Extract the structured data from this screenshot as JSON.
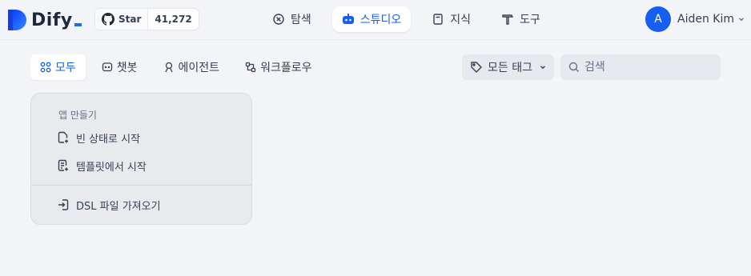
{
  "brand": {
    "name": "Dify",
    "accent": "#155eef"
  },
  "github": {
    "star_label": "Star",
    "star_count": "41,272"
  },
  "nav": [
    {
      "label": "탐색",
      "icon": "explore-icon",
      "active": false
    },
    {
      "label": "스튜디오",
      "icon": "robot-icon",
      "active": true
    },
    {
      "label": "지식",
      "icon": "book-icon",
      "active": false
    },
    {
      "label": "도구",
      "icon": "hammer-icon",
      "active": false
    }
  ],
  "user": {
    "initial": "A",
    "name": "Aiden Kim"
  },
  "filters": [
    {
      "label": "모두",
      "icon": "grid-icon",
      "active": true
    },
    {
      "label": "챗봇",
      "icon": "chat-icon",
      "active": false
    },
    {
      "label": "에이전트",
      "icon": "agent-icon",
      "active": false
    },
    {
      "label": "워크플로우",
      "icon": "workflow-icon",
      "active": false
    }
  ],
  "tag_filter": {
    "label": "모든 태그"
  },
  "search": {
    "placeholder": "검색"
  },
  "create_card": {
    "title": "앱 만들기",
    "items": [
      {
        "label": "빈 상태로 시작",
        "icon": "file-plus-icon"
      },
      {
        "label": "템플릿에서 시작",
        "icon": "template-icon"
      },
      {
        "label": "DSL 파일 가져오기",
        "icon": "import-icon"
      }
    ]
  }
}
